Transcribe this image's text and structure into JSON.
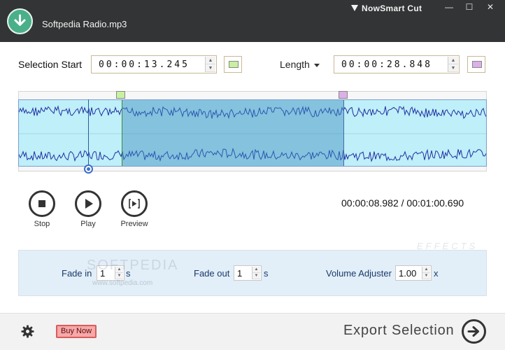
{
  "window": {
    "file_name": "Softpedia Radio.mp3",
    "app_title": "NowSmart Cut",
    "minimize_glyph": "—",
    "maximize_glyph": "☐",
    "close_glyph": "✕"
  },
  "selection": {
    "start_label": "Selection Start",
    "start_value": "00:00:13.245",
    "start_color": "#c9f0a0",
    "length_label": "Length",
    "length_value": "00:00:28.848",
    "length_color": "#dcb0e6"
  },
  "waveform": {
    "selection_start_fraction": 0.2191,
    "selection_end_fraction": 0.6937,
    "playhead_fraction": 0.1486,
    "wave_color": "#1f2fa5",
    "background_color": "#bfeff8",
    "selection_color": "#3c8cbe"
  },
  "transport": {
    "stop_label": "Stop",
    "play_label": "Play",
    "preview_label": "Preview",
    "current_time": "00:00:08.982",
    "separator": "/",
    "total_time": "00:01:00.690"
  },
  "effects": {
    "heading": "EFFECTS",
    "fade_in_label": "Fade in",
    "fade_in_value": "1",
    "fade_in_unit": "s",
    "fade_out_label": "Fade out",
    "fade_out_value": "1",
    "fade_out_unit": "s",
    "volume_label": "Volume Adjuster",
    "volume_value": "1.00",
    "volume_unit": "x"
  },
  "watermark": {
    "main": "SOFTPEDIA",
    "sub": "www.softpedia.com"
  },
  "footer": {
    "buy_label": "Buy Now",
    "export_label": "Export Selection"
  },
  "icons": {
    "app_logo": "download-arrow-icon",
    "settings": "gear-icon",
    "export": "arrow-right-icon"
  }
}
